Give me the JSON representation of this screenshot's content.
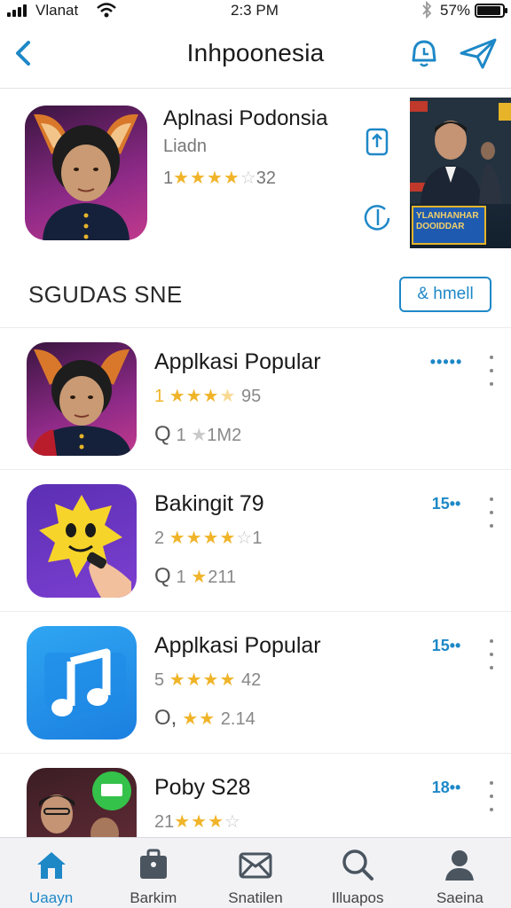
{
  "status_bar": {
    "carrier": "Vlanat",
    "time": "2:3 PM",
    "battery": "57%"
  },
  "nav": {
    "title": "Inhpoonesia",
    "back_icon": "chevron-left-icon",
    "actions": [
      "notification-icon",
      "send-icon"
    ]
  },
  "featured": {
    "name": "Aplnasi Podonsia",
    "subtitle": "Liadn",
    "rating_prefix": "1",
    "stars": 4,
    "rating_count": "32",
    "banner_text": "YLANHANHAR DOOIDDAR"
  },
  "section": {
    "title": "SGUDAS SNE",
    "see_all": "& hmell"
  },
  "apps": [
    {
      "name": "Applkasi Popular",
      "rating_prefix": "1",
      "stars": 3,
      "rating_count": "95",
      "meta_count": "1",
      "meta_stars": 1,
      "meta_value": "1M2",
      "action": "•••••",
      "icon": "person-avatar-icon"
    },
    {
      "name": "Bakingit 79",
      "rating_prefix": "2",
      "stars": 4,
      "rating_count": "1",
      "meta_count": "1",
      "meta_stars": 1,
      "meta_value": "211",
      "action": "15••",
      "icon": "cartoon-character-icon"
    },
    {
      "name": "Applkasi Popular",
      "rating_prefix": "5",
      "stars": 4,
      "rating_count": "42",
      "meta_count": "",
      "meta_stars": 2,
      "meta_value": "2.14",
      "action": "15••",
      "icon": "music-note-icon"
    },
    {
      "name": "Poby S28",
      "rating_prefix": "21",
      "stars": 3,
      "rating_count": "",
      "meta_count": "",
      "meta_stars": 0,
      "meta_value": "",
      "action": "18••",
      "icon": "chat-icon"
    }
  ],
  "tabs": [
    {
      "label": "Uaayn",
      "icon": "home-icon",
      "active": true
    },
    {
      "label": "Barkim",
      "icon": "briefcase-icon",
      "active": false
    },
    {
      "label": "Snatilen",
      "icon": "envelope-icon",
      "active": false
    },
    {
      "label": "Illuapos",
      "icon": "search-icon",
      "active": false
    },
    {
      "label": "Saeina",
      "icon": "profile-icon",
      "active": false
    }
  ],
  "colors": {
    "accent": "#1e88c7",
    "star": "#f0b429",
    "tabbar_bg": "#f2f2f5"
  }
}
